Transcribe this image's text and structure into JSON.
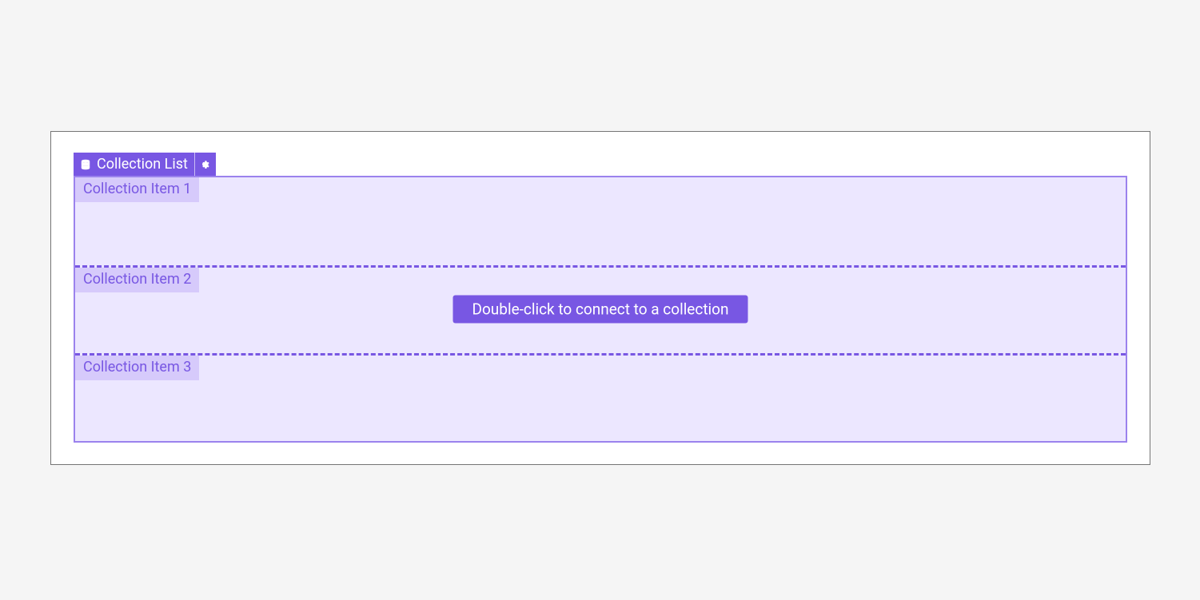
{
  "header": {
    "title": "Collection List"
  },
  "items": [
    {
      "label": "Collection Item 1"
    },
    {
      "label": "Collection Item 2"
    },
    {
      "label": "Collection Item 3"
    }
  ],
  "connect": {
    "label": "Double-click to connect to a collection"
  },
  "colors": {
    "accent": "#7857e3",
    "itemBg": "#ece7ff",
    "badgeBg": "#d6cafb",
    "listBorder": "#9b82ed"
  }
}
